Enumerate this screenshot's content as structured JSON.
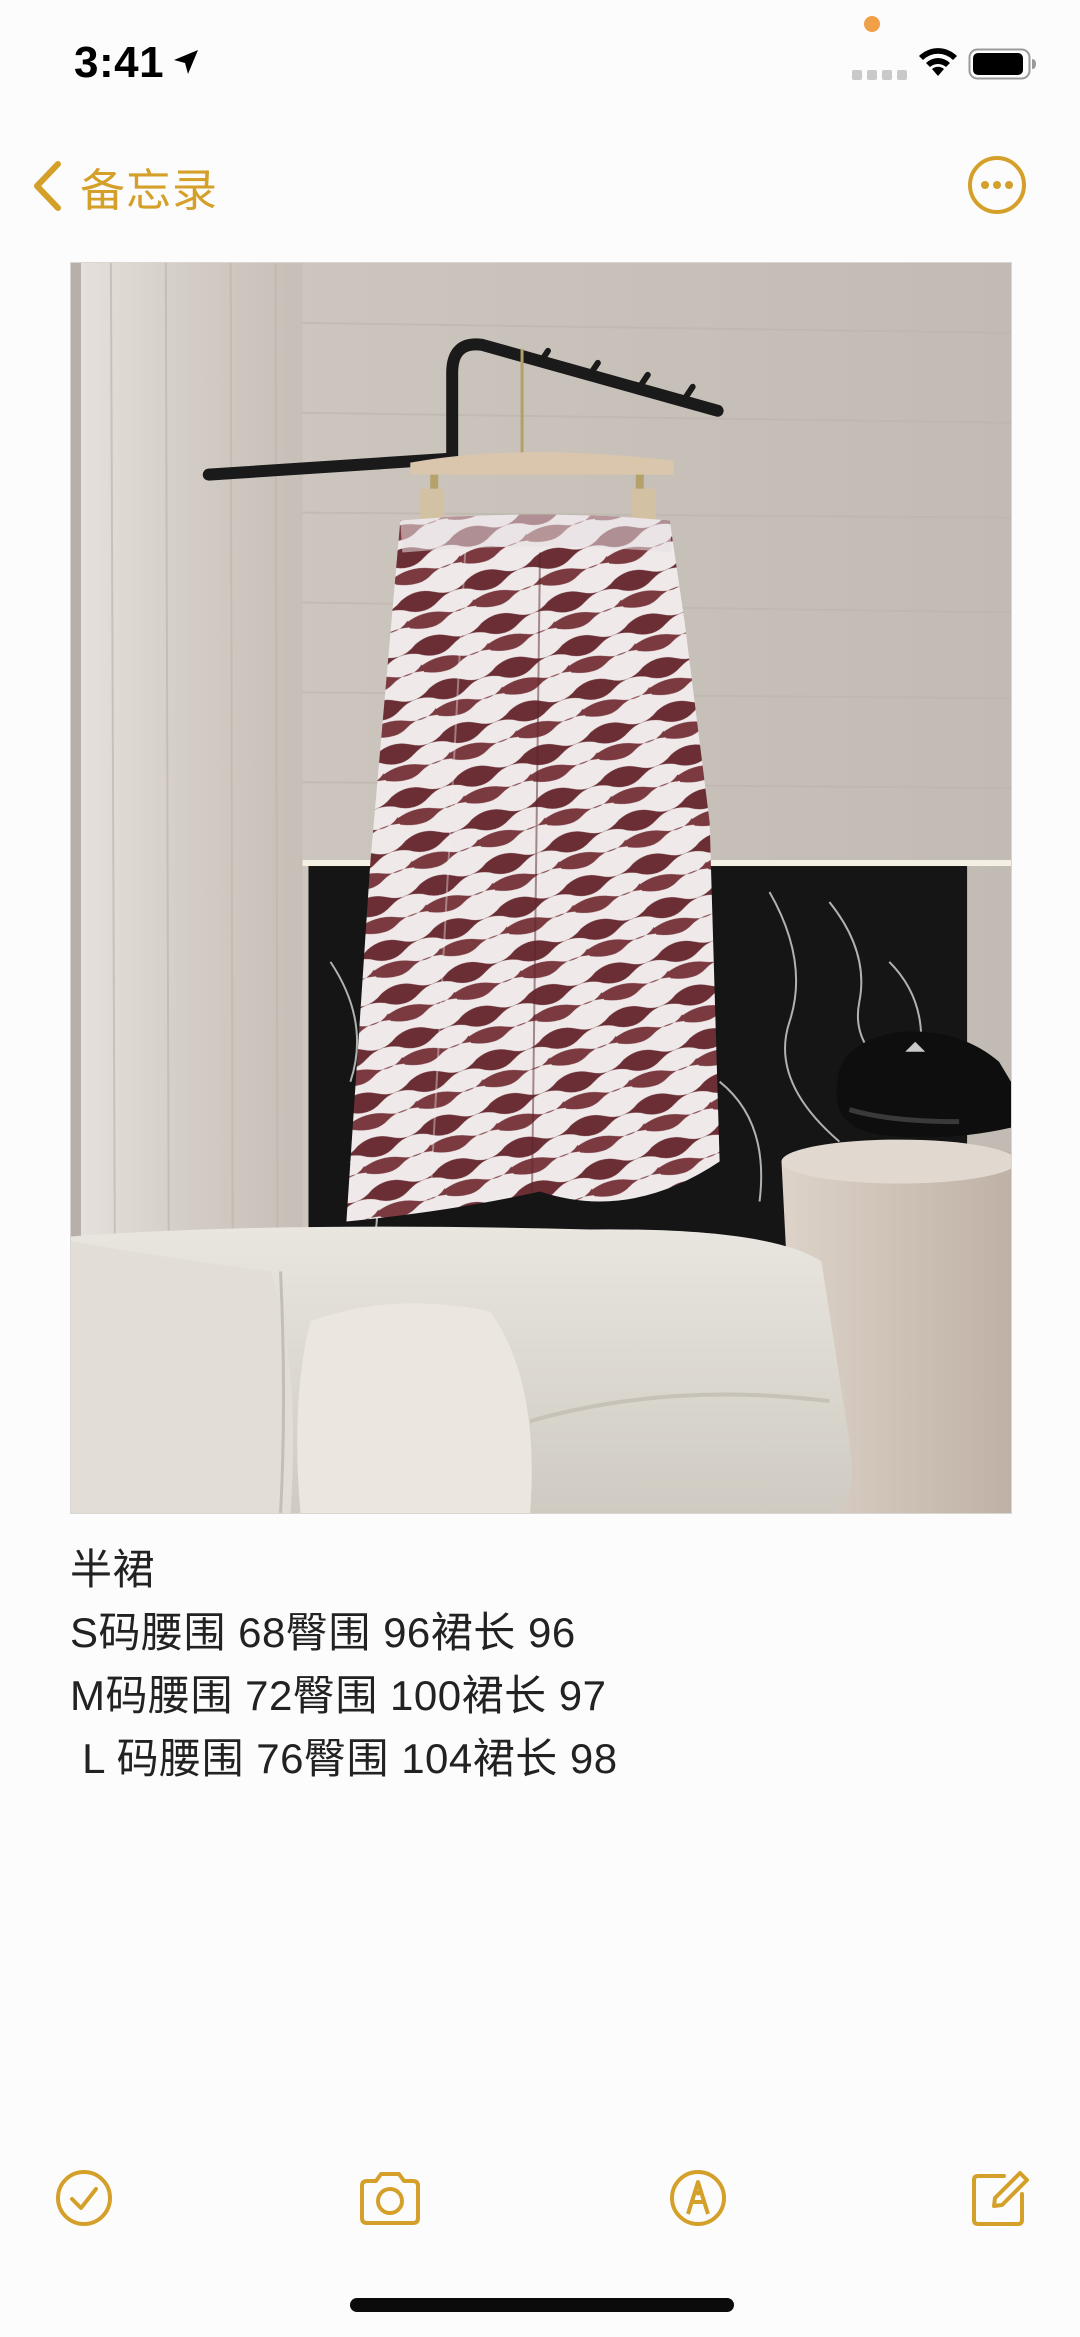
{
  "status_bar": {
    "time": "3:41"
  },
  "nav": {
    "back_label": "备忘录"
  },
  "note": {
    "lines": [
      "半裙",
      "S码腰围 68臀围 96裙长 96",
      "M码腰围 72臀围 100裙长 97",
      " L 码腰围 76臀围 104裙长 98"
    ]
  },
  "toolbar": {
    "items": [
      "checklist-icon",
      "camera-icon",
      "markup-icon",
      "compose-icon"
    ]
  },
  "colors": {
    "accent": "#d4a02a",
    "background": "#fdfcfd"
  }
}
